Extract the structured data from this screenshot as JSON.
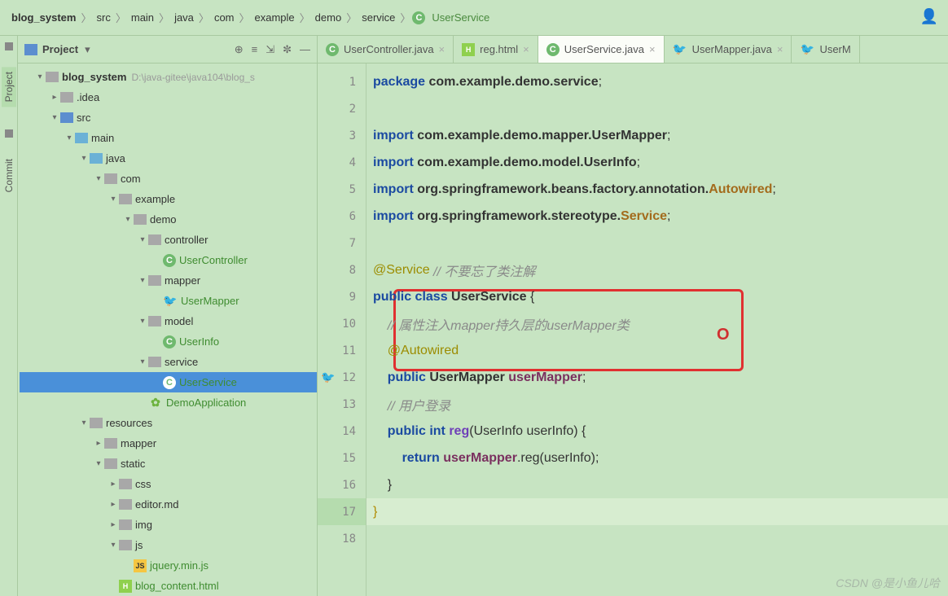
{
  "breadcrumb": {
    "items": [
      "blog_system",
      "src",
      "main",
      "java",
      "com",
      "example",
      "demo",
      "service",
      "UserService"
    ],
    "root_bold": true,
    "last_class_icon": true
  },
  "project": {
    "panel_label": "Project",
    "root_name": "blog_system",
    "root_path": "D:\\java-gitee\\java104\\blog_s"
  },
  "tree": [
    {
      "indent": 1,
      "arrow": "down",
      "icon": "folder",
      "label": "blog_system",
      "bold": true,
      "path_hint": "D:\\java-gitee\\java104\\blog_s"
    },
    {
      "indent": 2,
      "arrow": "right",
      "icon": "folder",
      "label": ".idea"
    },
    {
      "indent": 2,
      "arrow": "down",
      "icon": "folder blue",
      "label": "src"
    },
    {
      "indent": 3,
      "arrow": "down",
      "icon": "folder src",
      "label": "main"
    },
    {
      "indent": 4,
      "arrow": "down",
      "icon": "folder src",
      "label": "java"
    },
    {
      "indent": 5,
      "arrow": "down",
      "icon": "folder",
      "label": "com"
    },
    {
      "indent": 6,
      "arrow": "down",
      "icon": "folder",
      "label": "example"
    },
    {
      "indent": 7,
      "arrow": "down",
      "icon": "folder",
      "label": "demo"
    },
    {
      "indent": 8,
      "arrow": "down",
      "icon": "folder",
      "label": "controller"
    },
    {
      "indent": 9,
      "arrow": "none",
      "icon": "class-c",
      "label": "UserController",
      "green": true,
      "glyph": "C"
    },
    {
      "indent": 8,
      "arrow": "down",
      "icon": "folder",
      "label": "mapper"
    },
    {
      "indent": 9,
      "arrow": "none",
      "icon": "bird",
      "label": "UserMapper",
      "green": true,
      "glyph": "🐦"
    },
    {
      "indent": 8,
      "arrow": "down",
      "icon": "folder",
      "label": "model"
    },
    {
      "indent": 9,
      "arrow": "none",
      "icon": "class-c",
      "label": "UserInfo",
      "green": true,
      "glyph": "C"
    },
    {
      "indent": 8,
      "arrow": "down",
      "icon": "folder",
      "label": "service"
    },
    {
      "indent": 9,
      "arrow": "none",
      "icon": "class-c",
      "label": "UserService",
      "green": true,
      "selected": true,
      "glyph": "C"
    },
    {
      "indent": 8,
      "arrow": "none",
      "icon": "spring",
      "label": "DemoApplication",
      "green": true,
      "glyph": "✿"
    },
    {
      "indent": 4,
      "arrow": "down",
      "icon": "folder",
      "label": "resources"
    },
    {
      "indent": 5,
      "arrow": "right",
      "icon": "folder",
      "label": "mapper"
    },
    {
      "indent": 5,
      "arrow": "down",
      "icon": "folder",
      "label": "static"
    },
    {
      "indent": 6,
      "arrow": "right",
      "icon": "folder",
      "label": "css"
    },
    {
      "indent": 6,
      "arrow": "right",
      "icon": "folder",
      "label": "editor.md"
    },
    {
      "indent": 6,
      "arrow": "right",
      "icon": "folder",
      "label": "img"
    },
    {
      "indent": 6,
      "arrow": "down",
      "icon": "folder",
      "label": "js"
    },
    {
      "indent": 7,
      "arrow": "none",
      "icon": "js-i",
      "label": "jquery.min.js",
      "green": true,
      "glyph": "JS"
    },
    {
      "indent": 6,
      "arrow": "none",
      "icon": "html-h",
      "label": "blog_content.html",
      "green": true,
      "glyph": "H"
    }
  ],
  "tabs": [
    {
      "icon": "class-c",
      "glyph": "C",
      "label": "UserController.java",
      "active": false
    },
    {
      "icon": "html-h",
      "glyph": "H",
      "label": "reg.html",
      "active": false
    },
    {
      "icon": "class-c",
      "glyph": "C",
      "label": "UserService.java",
      "active": true
    },
    {
      "icon": "bird",
      "glyph": "🐦",
      "label": "UserMapper.java",
      "active": false
    },
    {
      "icon": "bird",
      "glyph": "🐦",
      "label": "UserM",
      "active": false,
      "truncated": true
    }
  ],
  "code": {
    "line_count": 18,
    "current_line": 17,
    "gutter_marks": {
      "12": "🐦"
    },
    "lines": [
      [
        {
          "t": "package ",
          "c": "kw"
        },
        {
          "t": "com.example.demo.service",
          "c": "pkg"
        },
        {
          "t": ";",
          "c": "punct"
        }
      ],
      [],
      [
        {
          "t": "import ",
          "c": "kw"
        },
        {
          "t": "com.example.demo.mapper.UserMapper",
          "c": "pkg"
        },
        {
          "t": ";",
          "c": "punct"
        }
      ],
      [
        {
          "t": "import ",
          "c": "kw"
        },
        {
          "t": "com.example.demo.model.UserInfo",
          "c": "pkg"
        },
        {
          "t": ";",
          "c": "punct"
        }
      ],
      [
        {
          "t": "import ",
          "c": "kw"
        },
        {
          "t": "org.springframework.beans.factory.annotation.",
          "c": "pkg"
        },
        {
          "t": "Autowired",
          "c": "cls"
        },
        {
          "t": ";",
          "c": "punct"
        }
      ],
      [
        {
          "t": "import ",
          "c": "kw"
        },
        {
          "t": "org.springframework.stereotype.",
          "c": "pkg"
        },
        {
          "t": "Service",
          "c": "cls"
        },
        {
          "t": ";",
          "c": "punct"
        }
      ],
      [],
      [
        {
          "t": "@Service",
          "c": "anno"
        },
        {
          "t": " // 不要忘了类注解",
          "c": "cmt"
        }
      ],
      [
        {
          "t": "public class ",
          "c": "kw"
        },
        {
          "t": "UserService ",
          "c": "pkg"
        },
        {
          "t": "{",
          "c": "brace"
        }
      ],
      [
        {
          "t": "    // 属性注入mapper持久层的userMapper类",
          "c": "cmt"
        }
      ],
      [
        {
          "t": "    ",
          "c": ""
        },
        {
          "t": "@Autowired",
          "c": "anno"
        }
      ],
      [
        {
          "t": "    ",
          "c": ""
        },
        {
          "t": "public ",
          "c": "kw"
        },
        {
          "t": "UserMapper ",
          "c": "pkg"
        },
        {
          "t": "userMapper",
          "c": "fld"
        },
        {
          "t": ";",
          "c": "punct"
        }
      ],
      [
        {
          "t": "    // 用户登录",
          "c": "cmt"
        }
      ],
      [
        {
          "t": "    ",
          "c": ""
        },
        {
          "t": "public int ",
          "c": "kw"
        },
        {
          "t": "reg",
          "c": "mthd"
        },
        {
          "t": "(UserInfo userInfo) {",
          "c": "punct"
        }
      ],
      [
        {
          "t": "        ",
          "c": ""
        },
        {
          "t": "return ",
          "c": "kw"
        },
        {
          "t": "userMapper",
          "c": "fld"
        },
        {
          "t": ".reg(userInfo);",
          "c": "punct"
        }
      ],
      [
        {
          "t": "    }",
          "c": "brace"
        }
      ],
      [
        {
          "t": "}",
          "c": "brace warn"
        }
      ],
      []
    ]
  },
  "rail": {
    "tabs": [
      "Project",
      "Commit"
    ]
  },
  "watermark": "CSDN @是小鱼儿哈"
}
